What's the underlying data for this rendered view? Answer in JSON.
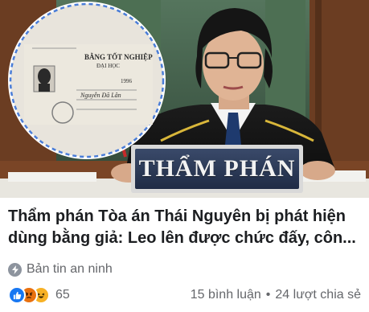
{
  "photo": {
    "nameplate": "THẨM PHÁN",
    "certificate": {
      "title": "BẰNG TỐT NGHIỆP",
      "subtitle": "ĐẠI HỌC",
      "field_year": "1996",
      "signature": "Nguyễn Đã Lân"
    }
  },
  "post": {
    "headline": "Thẩm phán Tòa án Thái Nguyên bị phát hiện dùng bằng giả: Leo lên được chức đấy, côn...",
    "source": "Bản tin an ninh",
    "reactions_count": "65",
    "comments": "15 bình luận",
    "separator": "•",
    "shares": "24 lượt chia sẻ"
  },
  "colors": {
    "text_primary": "#1c1e21",
    "text_secondary": "#65676b",
    "like_blue": "#1877f2",
    "angry_orange": "#e9710f",
    "haha_yellow": "#f7b125"
  }
}
